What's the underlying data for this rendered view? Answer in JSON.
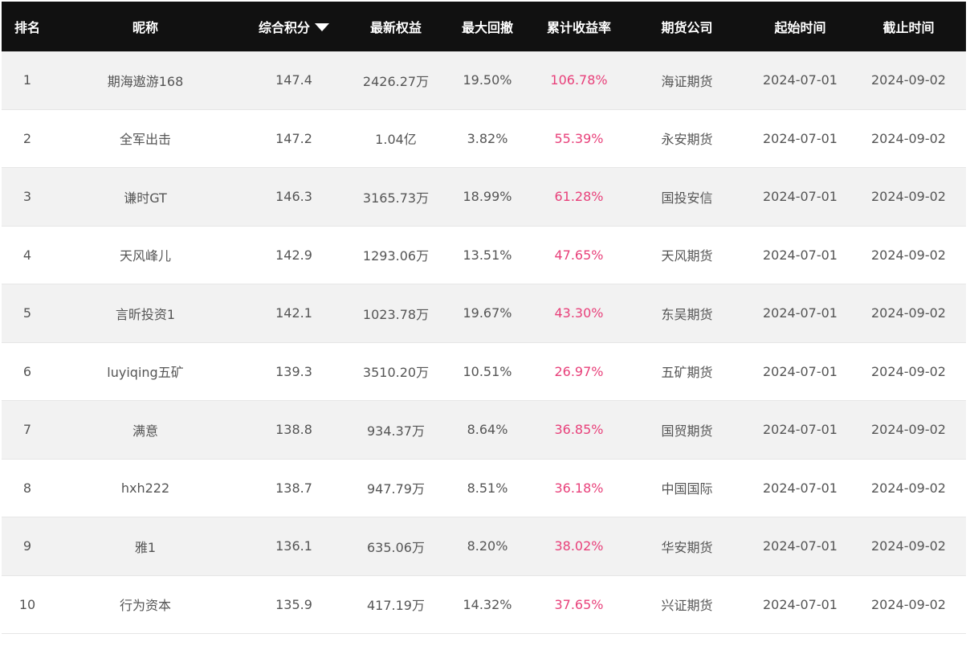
{
  "header": {
    "rank": "排名",
    "nickname": "昵称",
    "score": "综合积分",
    "equity": "最新权益",
    "drawdown": "最大回撤",
    "return": "累计收益率",
    "company": "期货公司",
    "start": "起始时间",
    "end": "截止时间"
  },
  "rows": [
    {
      "rank": "1",
      "nickname": "期海遨游168",
      "score": "147.4",
      "equity": "2426.27万",
      "drawdown": "19.50%",
      "return": "106.78%",
      "company": "海证期货",
      "start": "2024-07-01",
      "end": "2024-09-02"
    },
    {
      "rank": "2",
      "nickname": "全军出击",
      "score": "147.2",
      "equity": "1.04亿",
      "drawdown": "3.82%",
      "return": "55.39%",
      "company": "永安期货",
      "start": "2024-07-01",
      "end": "2024-09-02"
    },
    {
      "rank": "3",
      "nickname": "谦时GT",
      "score": "146.3",
      "equity": "3165.73万",
      "drawdown": "18.99%",
      "return": "61.28%",
      "company": "国投安信",
      "start": "2024-07-01",
      "end": "2024-09-02"
    },
    {
      "rank": "4",
      "nickname": "天风峰儿",
      "score": "142.9",
      "equity": "1293.06万",
      "drawdown": "13.51%",
      "return": "47.65%",
      "company": "天风期货",
      "start": "2024-07-01",
      "end": "2024-09-02"
    },
    {
      "rank": "5",
      "nickname": "言昕投资1",
      "score": "142.1",
      "equity": "1023.78万",
      "drawdown": "19.67%",
      "return": "43.30%",
      "company": "东吴期货",
      "start": "2024-07-01",
      "end": "2024-09-02"
    },
    {
      "rank": "6",
      "nickname": "luyiqing五矿",
      "score": "139.3",
      "equity": "3510.20万",
      "drawdown": "10.51%",
      "return": "26.97%",
      "company": "五矿期货",
      "start": "2024-07-01",
      "end": "2024-09-02"
    },
    {
      "rank": "7",
      "nickname": "满意",
      "score": "138.8",
      "equity": "934.37万",
      "drawdown": "8.64%",
      "return": "36.85%",
      "company": "国贸期货",
      "start": "2024-07-01",
      "end": "2024-09-02"
    },
    {
      "rank": "8",
      "nickname": "hxh222",
      "score": "138.7",
      "equity": "947.79万",
      "drawdown": "8.51%",
      "return": "36.18%",
      "company": "中国国际",
      "start": "2024-07-01",
      "end": "2024-09-02"
    },
    {
      "rank": "9",
      "nickname": "雅1",
      "score": "136.1",
      "equity": "635.06万",
      "drawdown": "8.20%",
      "return": "38.02%",
      "company": "华安期货",
      "start": "2024-07-01",
      "end": "2024-09-02"
    },
    {
      "rank": "10",
      "nickname": "行为资本",
      "score": "135.9",
      "equity": "417.19万",
      "drawdown": "14.32%",
      "return": "37.65%",
      "company": "兴证期货",
      "start": "2024-07-01",
      "end": "2024-09-02"
    }
  ],
  "colors": {
    "header_bg": "#111111",
    "header_text": "#ffffff",
    "row_alt_bg": "#f2f2f2",
    "return_text": "#e8407a"
  },
  "icons": {
    "sort": "sort-desc-icon"
  }
}
